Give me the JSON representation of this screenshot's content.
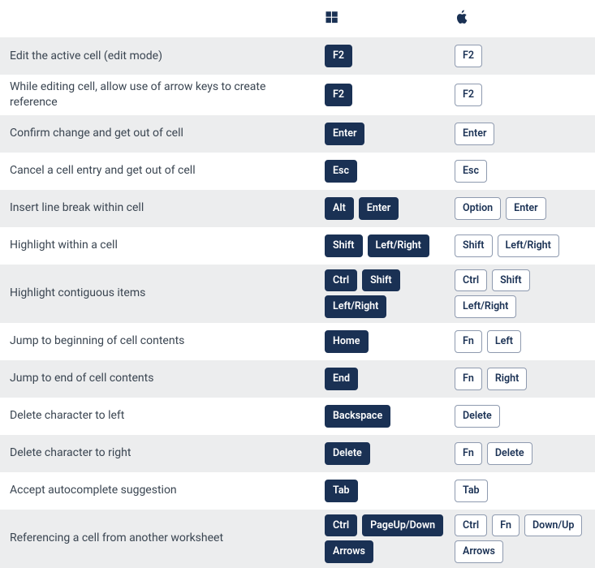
{
  "columns": {
    "windows_icon": "windows-icon",
    "mac_icon": "apple-icon"
  },
  "rows": [
    {
      "desc": "Edit the active cell (edit mode)",
      "win": [
        "F2"
      ],
      "mac": [
        "F2"
      ]
    },
    {
      "desc": "While editing cell, allow use of arrow keys to create reference",
      "win": [
        "F2"
      ],
      "mac": [
        "F2"
      ]
    },
    {
      "desc": "Confirm change and get out of cell",
      "win": [
        "Enter"
      ],
      "mac": [
        "Enter"
      ]
    },
    {
      "desc": "Cancel a cell entry and get out of cell",
      "win": [
        "Esc"
      ],
      "mac": [
        "Esc"
      ]
    },
    {
      "desc": "Insert line break within cell",
      "win": [
        "Alt",
        "Enter"
      ],
      "mac": [
        "Option",
        "Enter"
      ]
    },
    {
      "desc": "Highlight within a cell",
      "win": [
        "Shift",
        "Left/Right"
      ],
      "mac": [
        "Shift",
        "Left/Right"
      ]
    },
    {
      "desc": "Highlight contiguous items",
      "win": [
        "Ctrl",
        "Shift",
        "Left/Right"
      ],
      "mac": [
        "Ctrl",
        "Shift",
        "Left/Right"
      ]
    },
    {
      "desc": "Jump to beginning of cell contents",
      "win": [
        "Home"
      ],
      "mac": [
        "Fn",
        "Left"
      ]
    },
    {
      "desc": "Jump to end of cell contents",
      "win": [
        "End"
      ],
      "mac": [
        "Fn",
        "Right"
      ]
    },
    {
      "desc": "Delete character to left",
      "win": [
        "Backspace"
      ],
      "mac": [
        "Delete"
      ]
    },
    {
      "desc": "Delete character to right",
      "win": [
        "Delete"
      ],
      "mac": [
        "Fn",
        "Delete"
      ]
    },
    {
      "desc": "Accept autocomplete suggestion",
      "win": [
        "Tab"
      ],
      "mac": [
        "Tab"
      ]
    },
    {
      "desc": "Referencing a cell from another worksheet",
      "win": [
        "Ctrl",
        "PageUp/Down",
        "Arrows"
      ],
      "mac": [
        "Ctrl",
        "Fn",
        "Down/Up",
        "Arrows"
      ]
    }
  ]
}
